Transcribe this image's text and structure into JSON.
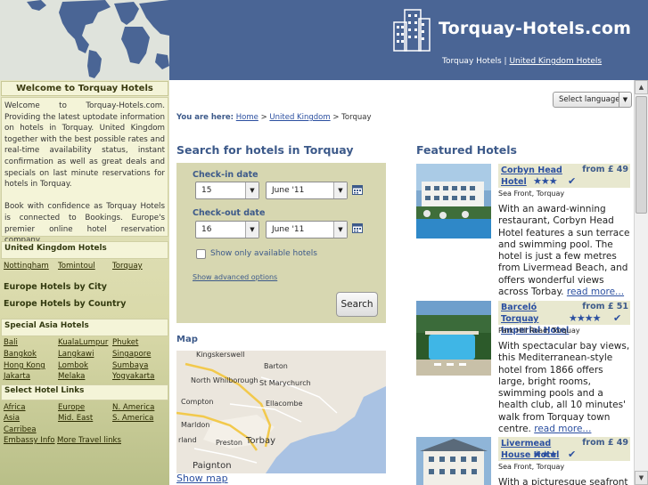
{
  "header": {
    "site_title": "Torquay-Hotels.com",
    "link_home": "Torquay Hotels",
    "separator": "|",
    "link_uk": "United Kingdom Hotels"
  },
  "sidebar": {
    "welcome_title": "Welcome to Torquay Hotels",
    "welcome_p1": "Welcome to Torquay-Hotels.com. Providing the latest uptodate information on hotels in Torquay. United Kingdom together with the best possible rates and real-time availability status, instant confirmation as well as great deals and specials on last minute reservations for hotels in Torquay.",
    "welcome_p2": "Book with confidence as Torquay Hotels is connected to Bookings. Europe's premier online hotel reservation company.",
    "uk_title": "United Kingdom Hotels",
    "uk_links": [
      "Nottingham",
      "Tomintoul",
      "Torquay"
    ],
    "europe_city": "Europe Hotels by City",
    "europe_country": "Europe Hotels by Country",
    "asia_title": "Special Asia Hotels",
    "asia_links": [
      "Bali",
      "KualaLumpur",
      "Phuket",
      "Bangkok",
      "Langkawi",
      "Singapore",
      "Hong Kong",
      "Lombok",
      "Sumbaya",
      "Jakarta",
      "Melaka",
      "Yogyakarta"
    ],
    "select_title": "Select Hotel Links",
    "select_links": [
      "Africa",
      "Europe",
      "N. America",
      "Asia",
      "Mid. East",
      "S. America",
      "Carribea"
    ],
    "embassy": "Embassy Info",
    "more_travel": "More Travel links"
  },
  "breadcrumb": {
    "label": "You are here:",
    "home": "Home",
    "uk": "United Kingdom",
    "current": "Torquay",
    "sep": ">"
  },
  "language_select": {
    "value": "Select language"
  },
  "search": {
    "title": "Search for hotels in Torquay",
    "checkin_label": "Check-in date",
    "checkin_day": "15",
    "checkin_month": "June '11",
    "checkout_label": "Check-out date",
    "checkout_day": "16",
    "checkout_month": "June '11",
    "available_only": "Show only available hotels",
    "advanced": "Show advanced options",
    "button": "Search"
  },
  "map": {
    "title": "Map",
    "show_map": "Show map",
    "places": [
      "Kingskerswell",
      "Barton",
      "North Whilborough",
      "St Marychurch",
      "Compton",
      "Ellacombe",
      "Marldon",
      "rland",
      "Preston",
      "Torbay",
      "Paignton"
    ]
  },
  "featured": {
    "title": "Featured Hotels",
    "hotels": [
      {
        "name": "Corbyn Head Hotel",
        "price": "from £ 49",
        "stars": "★★★",
        "address": "Sea Front, Torquay",
        "description": "With an award-winning restaurant, Corbyn Head Hotel features a sun terrace and swimming pool. The hotel is just a few metres from Livermead Beach, and offers wonderful views across Torbay.",
        "more": "read more..."
      },
      {
        "name": "Barceló Torquay Imperial Hotel",
        "price": "from £ 51",
        "stars": "★★★★",
        "address": "Park Hill Road, Torquay",
        "description": "With spectacular bay views, this Mediterranean-style hotel from 1866 offers large, bright rooms, swimming pools and a health club, all 10 minutes' walk from Torquay town centre.",
        "more": "read more..."
      },
      {
        "name": "Livermead House Hotel",
        "price": "from £ 49",
        "stars": "★★★",
        "address": "Sea Front, Torquay",
        "description": "With a picturesque seafront"
      }
    ]
  },
  "colors": {
    "header_blue": "#4a6595",
    "sidebar_bg": "#e6e6c5",
    "search_box": "#d7d7b1",
    "link_blue": "#2b4fa0",
    "heading_blue": "#3d5a8a"
  }
}
